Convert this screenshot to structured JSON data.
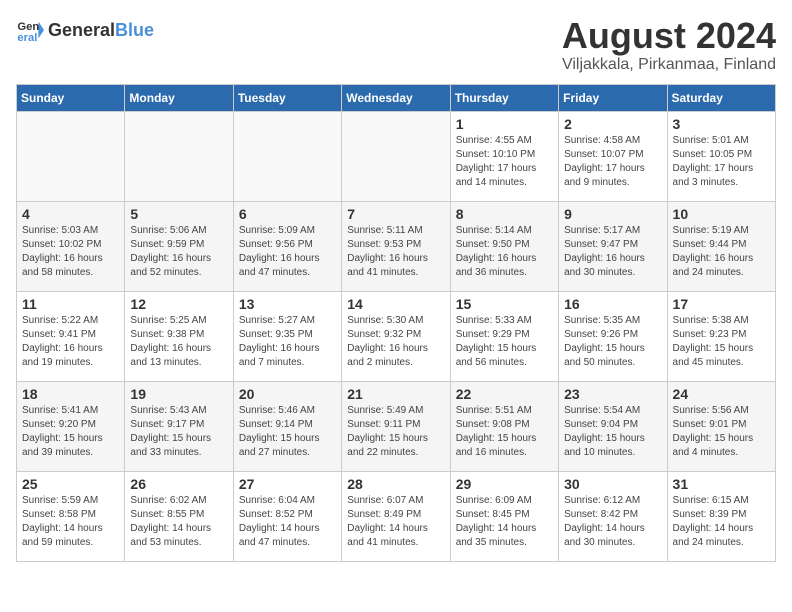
{
  "logo": {
    "general": "General",
    "blue": "Blue"
  },
  "header": {
    "title": "August 2024",
    "subtitle": "Viljakkala, Pirkanmaa, Finland"
  },
  "days_of_week": [
    "Sunday",
    "Monday",
    "Tuesday",
    "Wednesday",
    "Thursday",
    "Friday",
    "Saturday"
  ],
  "weeks": [
    [
      {
        "day": "",
        "info": ""
      },
      {
        "day": "",
        "info": ""
      },
      {
        "day": "",
        "info": ""
      },
      {
        "day": "",
        "info": ""
      },
      {
        "day": "1",
        "info": "Sunrise: 4:55 AM\nSunset: 10:10 PM\nDaylight: 17 hours\nand 14 minutes."
      },
      {
        "day": "2",
        "info": "Sunrise: 4:58 AM\nSunset: 10:07 PM\nDaylight: 17 hours\nand 9 minutes."
      },
      {
        "day": "3",
        "info": "Sunrise: 5:01 AM\nSunset: 10:05 PM\nDaylight: 17 hours\nand 3 minutes."
      }
    ],
    [
      {
        "day": "4",
        "info": "Sunrise: 5:03 AM\nSunset: 10:02 PM\nDaylight: 16 hours\nand 58 minutes."
      },
      {
        "day": "5",
        "info": "Sunrise: 5:06 AM\nSunset: 9:59 PM\nDaylight: 16 hours\nand 52 minutes."
      },
      {
        "day": "6",
        "info": "Sunrise: 5:09 AM\nSunset: 9:56 PM\nDaylight: 16 hours\nand 47 minutes."
      },
      {
        "day": "7",
        "info": "Sunrise: 5:11 AM\nSunset: 9:53 PM\nDaylight: 16 hours\nand 41 minutes."
      },
      {
        "day": "8",
        "info": "Sunrise: 5:14 AM\nSunset: 9:50 PM\nDaylight: 16 hours\nand 36 minutes."
      },
      {
        "day": "9",
        "info": "Sunrise: 5:17 AM\nSunset: 9:47 PM\nDaylight: 16 hours\nand 30 minutes."
      },
      {
        "day": "10",
        "info": "Sunrise: 5:19 AM\nSunset: 9:44 PM\nDaylight: 16 hours\nand 24 minutes."
      }
    ],
    [
      {
        "day": "11",
        "info": "Sunrise: 5:22 AM\nSunset: 9:41 PM\nDaylight: 16 hours\nand 19 minutes."
      },
      {
        "day": "12",
        "info": "Sunrise: 5:25 AM\nSunset: 9:38 PM\nDaylight: 16 hours\nand 13 minutes."
      },
      {
        "day": "13",
        "info": "Sunrise: 5:27 AM\nSunset: 9:35 PM\nDaylight: 16 hours\nand 7 minutes."
      },
      {
        "day": "14",
        "info": "Sunrise: 5:30 AM\nSunset: 9:32 PM\nDaylight: 16 hours\nand 2 minutes."
      },
      {
        "day": "15",
        "info": "Sunrise: 5:33 AM\nSunset: 9:29 PM\nDaylight: 15 hours\nand 56 minutes."
      },
      {
        "day": "16",
        "info": "Sunrise: 5:35 AM\nSunset: 9:26 PM\nDaylight: 15 hours\nand 50 minutes."
      },
      {
        "day": "17",
        "info": "Sunrise: 5:38 AM\nSunset: 9:23 PM\nDaylight: 15 hours\nand 45 minutes."
      }
    ],
    [
      {
        "day": "18",
        "info": "Sunrise: 5:41 AM\nSunset: 9:20 PM\nDaylight: 15 hours\nand 39 minutes."
      },
      {
        "day": "19",
        "info": "Sunrise: 5:43 AM\nSunset: 9:17 PM\nDaylight: 15 hours\nand 33 minutes."
      },
      {
        "day": "20",
        "info": "Sunrise: 5:46 AM\nSunset: 9:14 PM\nDaylight: 15 hours\nand 27 minutes."
      },
      {
        "day": "21",
        "info": "Sunrise: 5:49 AM\nSunset: 9:11 PM\nDaylight: 15 hours\nand 22 minutes."
      },
      {
        "day": "22",
        "info": "Sunrise: 5:51 AM\nSunset: 9:08 PM\nDaylight: 15 hours\nand 16 minutes."
      },
      {
        "day": "23",
        "info": "Sunrise: 5:54 AM\nSunset: 9:04 PM\nDaylight: 15 hours\nand 10 minutes."
      },
      {
        "day": "24",
        "info": "Sunrise: 5:56 AM\nSunset: 9:01 PM\nDaylight: 15 hours\nand 4 minutes."
      }
    ],
    [
      {
        "day": "25",
        "info": "Sunrise: 5:59 AM\nSunset: 8:58 PM\nDaylight: 14 hours\nand 59 minutes."
      },
      {
        "day": "26",
        "info": "Sunrise: 6:02 AM\nSunset: 8:55 PM\nDaylight: 14 hours\nand 53 minutes."
      },
      {
        "day": "27",
        "info": "Sunrise: 6:04 AM\nSunset: 8:52 PM\nDaylight: 14 hours\nand 47 minutes."
      },
      {
        "day": "28",
        "info": "Sunrise: 6:07 AM\nSunset: 8:49 PM\nDaylight: 14 hours\nand 41 minutes."
      },
      {
        "day": "29",
        "info": "Sunrise: 6:09 AM\nSunset: 8:45 PM\nDaylight: 14 hours\nand 35 minutes."
      },
      {
        "day": "30",
        "info": "Sunrise: 6:12 AM\nSunset: 8:42 PM\nDaylight: 14 hours\nand 30 minutes."
      },
      {
        "day": "31",
        "info": "Sunrise: 6:15 AM\nSunset: 8:39 PM\nDaylight: 14 hours\nand 24 minutes."
      }
    ]
  ]
}
